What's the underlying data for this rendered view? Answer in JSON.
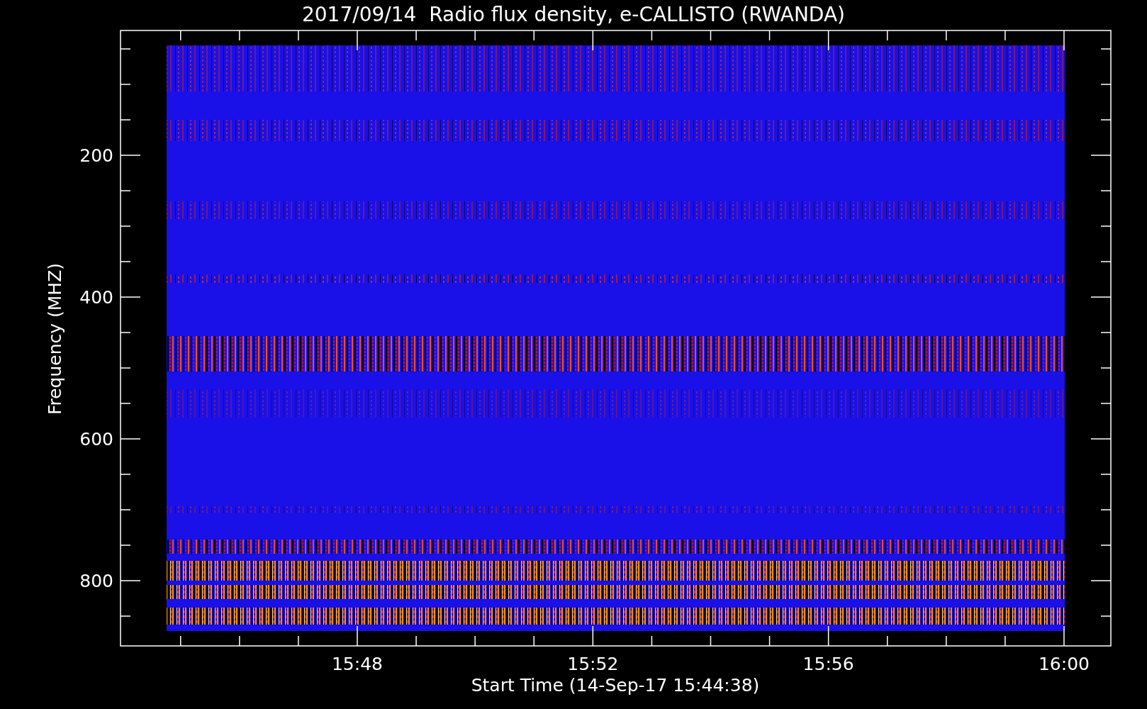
{
  "title": "2017/09/14  Radio flux density, e-CALLISTO (RWANDA)",
  "chart": {
    "ylabel": "Frequency (MHZ)",
    "xlabel": "Start Time (14-Sep-17 15:44:38)",
    "yticks": [
      "200",
      "400",
      "600",
      "800"
    ],
    "xticks": [
      "15:48",
      "15:52",
      "15:56",
      "16:00"
    ]
  }
}
